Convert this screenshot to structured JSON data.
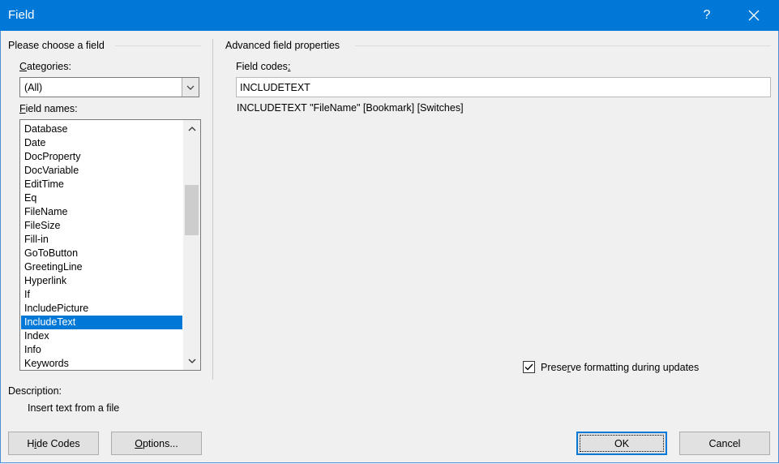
{
  "window": {
    "title": "Field",
    "help_glyph": "?"
  },
  "left_panel": {
    "group_title": "Please choose a field",
    "categories": {
      "label_access": "C",
      "label_rest": "ategories:",
      "selected": "(All)"
    },
    "field_names": {
      "label_access": "F",
      "label_rest": "ield names:",
      "items": [
        "Database",
        "Date",
        "DocProperty",
        "DocVariable",
        "EditTime",
        "Eq",
        "FileName",
        "FileSize",
        "Fill-in",
        "GoToButton",
        "GreetingLine",
        "Hyperlink",
        "If",
        "IncludePicture",
        "IncludeText",
        "Index",
        "Info",
        "Keywords"
      ],
      "selected": "IncludeText"
    },
    "description": {
      "label": "Description:",
      "text": "Insert text from a file"
    }
  },
  "right_panel": {
    "group_title": "Advanced field properties",
    "field_codes": {
      "label_pre": "Field codes",
      "label_access": ":",
      "value": "INCLUDETEXT"
    },
    "syntax": "INCLUDETEXT \"FileName\" [Bookmark] [Switches]",
    "preserve": {
      "label_pre": "Prese",
      "label_access": "r",
      "label_post": "ve formatting during updates",
      "checked": true
    }
  },
  "buttons": {
    "hide_codes": {
      "pre": "H",
      "access": "i",
      "post": "de Codes"
    },
    "options": {
      "pre": "",
      "access": "O",
      "post": "ptions..."
    },
    "ok": "OK",
    "cancel": "Cancel"
  }
}
